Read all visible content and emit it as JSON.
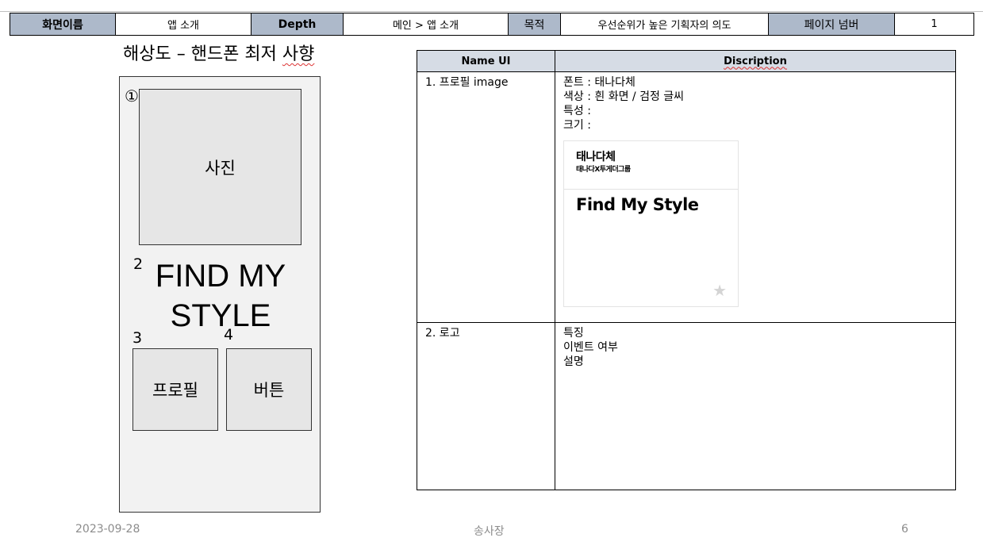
{
  "header": {
    "screen_name_label": "화면이름",
    "screen_name_value": "앱 소개",
    "depth_label": "Depth",
    "depth_value": "메인 > 앱 소개",
    "purpose_label": "목적",
    "purpose_value": "우선순위가 높은 기획자의 의도",
    "page_number_label": "페이지 넘버",
    "page_number_value": "1"
  },
  "resolution_title": {
    "prefix": "해상도 – 핸드폰 최저 ",
    "underlined": "사향"
  },
  "phone": {
    "marker_1": "①",
    "photo_label": "사진",
    "marker_2": "2",
    "title_line1": "FIND MY",
    "title_line2": "STYLE",
    "marker_3": "3",
    "marker_4": "4",
    "profile_label": "프로필",
    "button_label": "버튼"
  },
  "desc_table": {
    "col_name": "Name UI",
    "col_desc": "Discription",
    "rows": [
      {
        "name": "1. 프로필 image",
        "lines": [
          "폰트 : 태나다체",
          "색상 : 흰 화면 / 검정 글씨",
          "특성 :",
          "크기 :"
        ]
      },
      {
        "name": "2. 로고",
        "lines": [
          "특징",
          "이벤트 여부",
          "설명"
        ]
      }
    ]
  },
  "font_card": {
    "font_name": "태나다체",
    "font_subtitle": "태나다X투게더그룹",
    "sample_text": "Find My Style",
    "star_icon": "star-icon",
    "star_color": "#d4d4d4"
  },
  "colors": {
    "header_label_bg": "#adb9ca",
    "table_header_bg": "#d6dce5",
    "phone_bg": "#f2f2f2",
    "box_bg": "#e6e6e6"
  },
  "footer": {
    "date": "2023-09-28",
    "author": "송사장",
    "page": "6"
  }
}
